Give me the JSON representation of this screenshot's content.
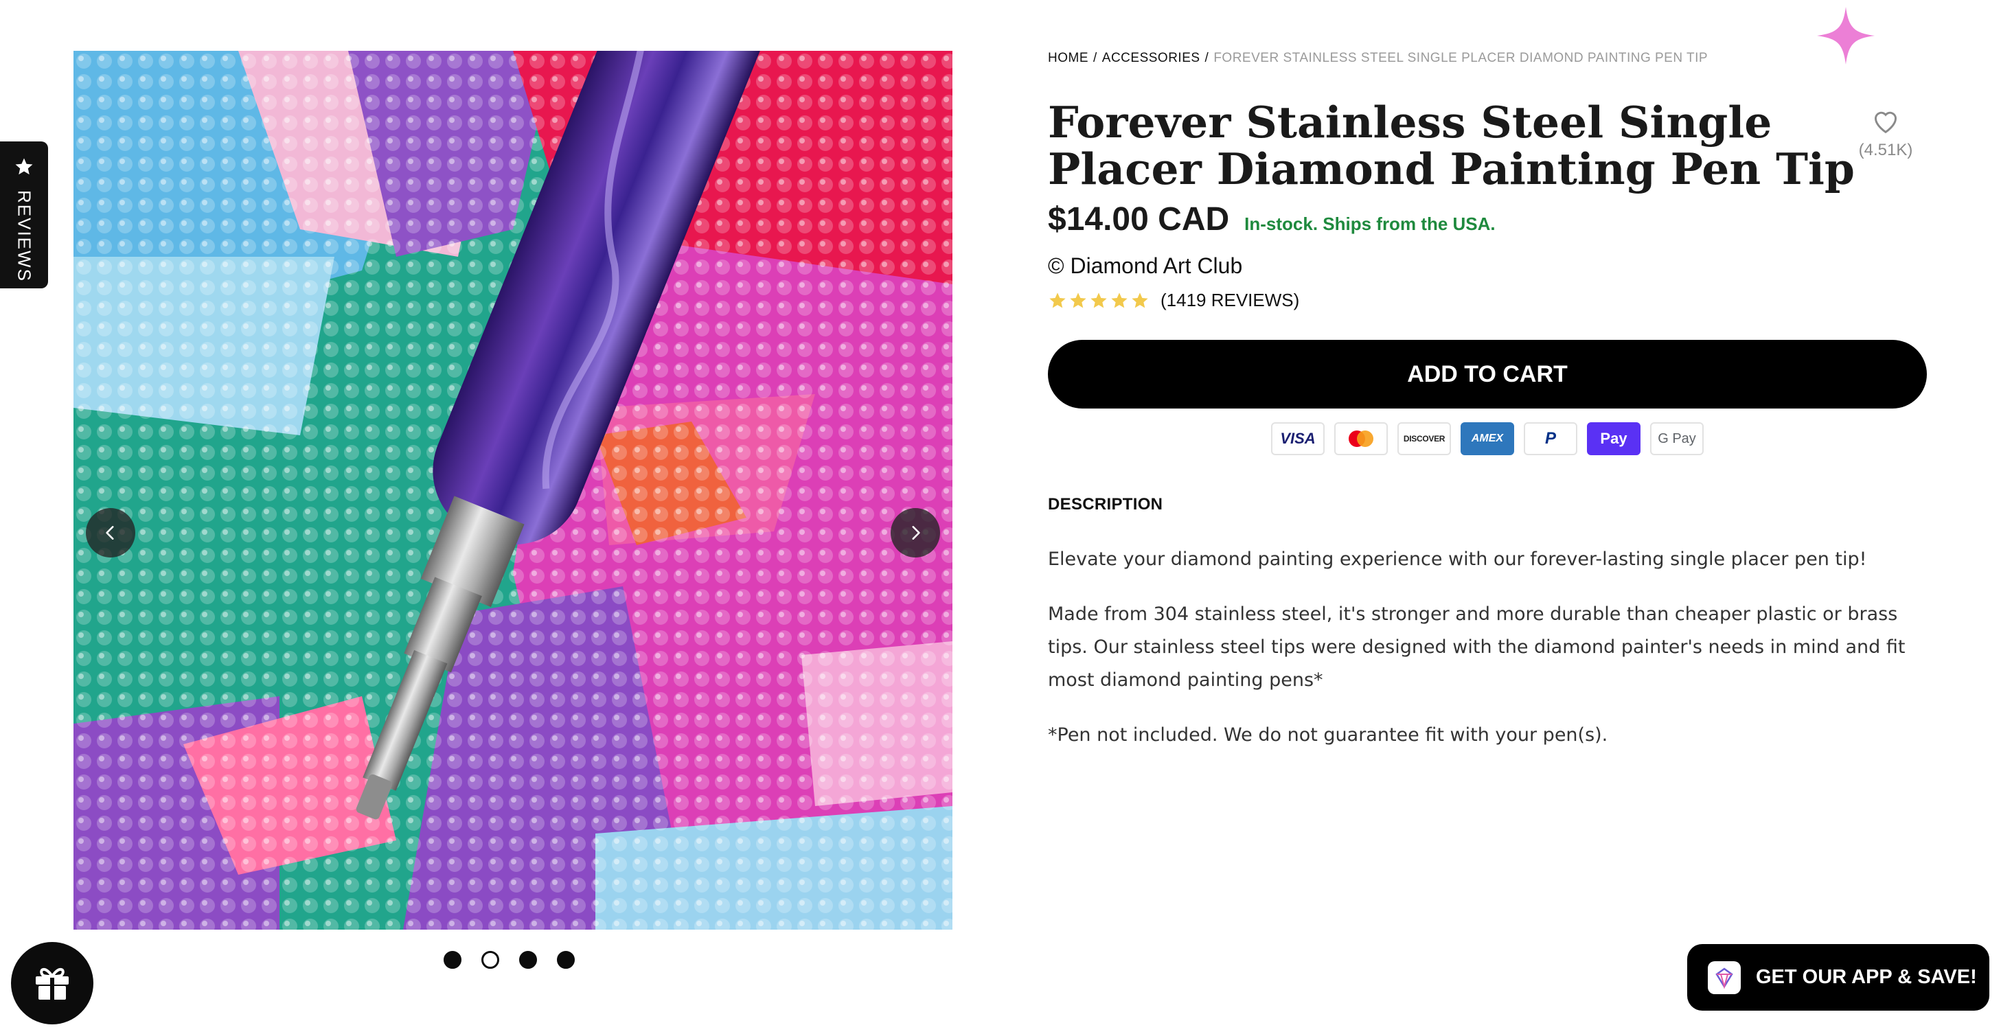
{
  "reviews_tab": {
    "label": "REVIEWS",
    "icon": "star-icon"
  },
  "breadcrumb": {
    "home": "HOME",
    "accessories": "ACCESSORIES",
    "current": "FOREVER STAINLESS STEEL SINGLE PLACER DIAMOND PAINTING PEN TIP",
    "separator": "/"
  },
  "product": {
    "title": "Forever Stainless Steel Single Placer Diamond Painting Pen Tip",
    "price": "$14.00 CAD",
    "stock": "In-stock. Ships from the USA.",
    "brand": "© Diamond Art Club",
    "rating": 5,
    "reviews": "(1419 REVIEWS)",
    "wishlist_count": "(4.51K)"
  },
  "gallery": {
    "slides": 4,
    "active_slide": 2,
    "prev_icon": "chevron-left-icon",
    "next_icon": "chevron-right-icon"
  },
  "cart": {
    "label": "ADD TO CART"
  },
  "payments": [
    "VISA",
    "Mastercard",
    "DISCOVER",
    "AMEX",
    "P",
    "Pay",
    "G Pay"
  ],
  "description": {
    "heading": "DESCRIPTION",
    "paragraphs": [
      "Elevate your diamond painting experience with our forever-lasting single placer pen tip!",
      "Made from 304 stainless steel, it's stronger and more durable than cheaper plastic or brass tips. Our stainless steel tips were designed with the diamond painter's needs in mind and fit most diamond painting pens*",
      "*Pen not included. We do not guarantee fit with your pen(s)."
    ]
  },
  "app_banner": {
    "label": "GET OUR APP & SAVE!"
  },
  "colors": {
    "stock_green": "#1f8a3e",
    "star_gold": "#f2c94c",
    "sparkle_pink": "#ec7fd6",
    "shoppay_purple": "#5a31f4"
  }
}
